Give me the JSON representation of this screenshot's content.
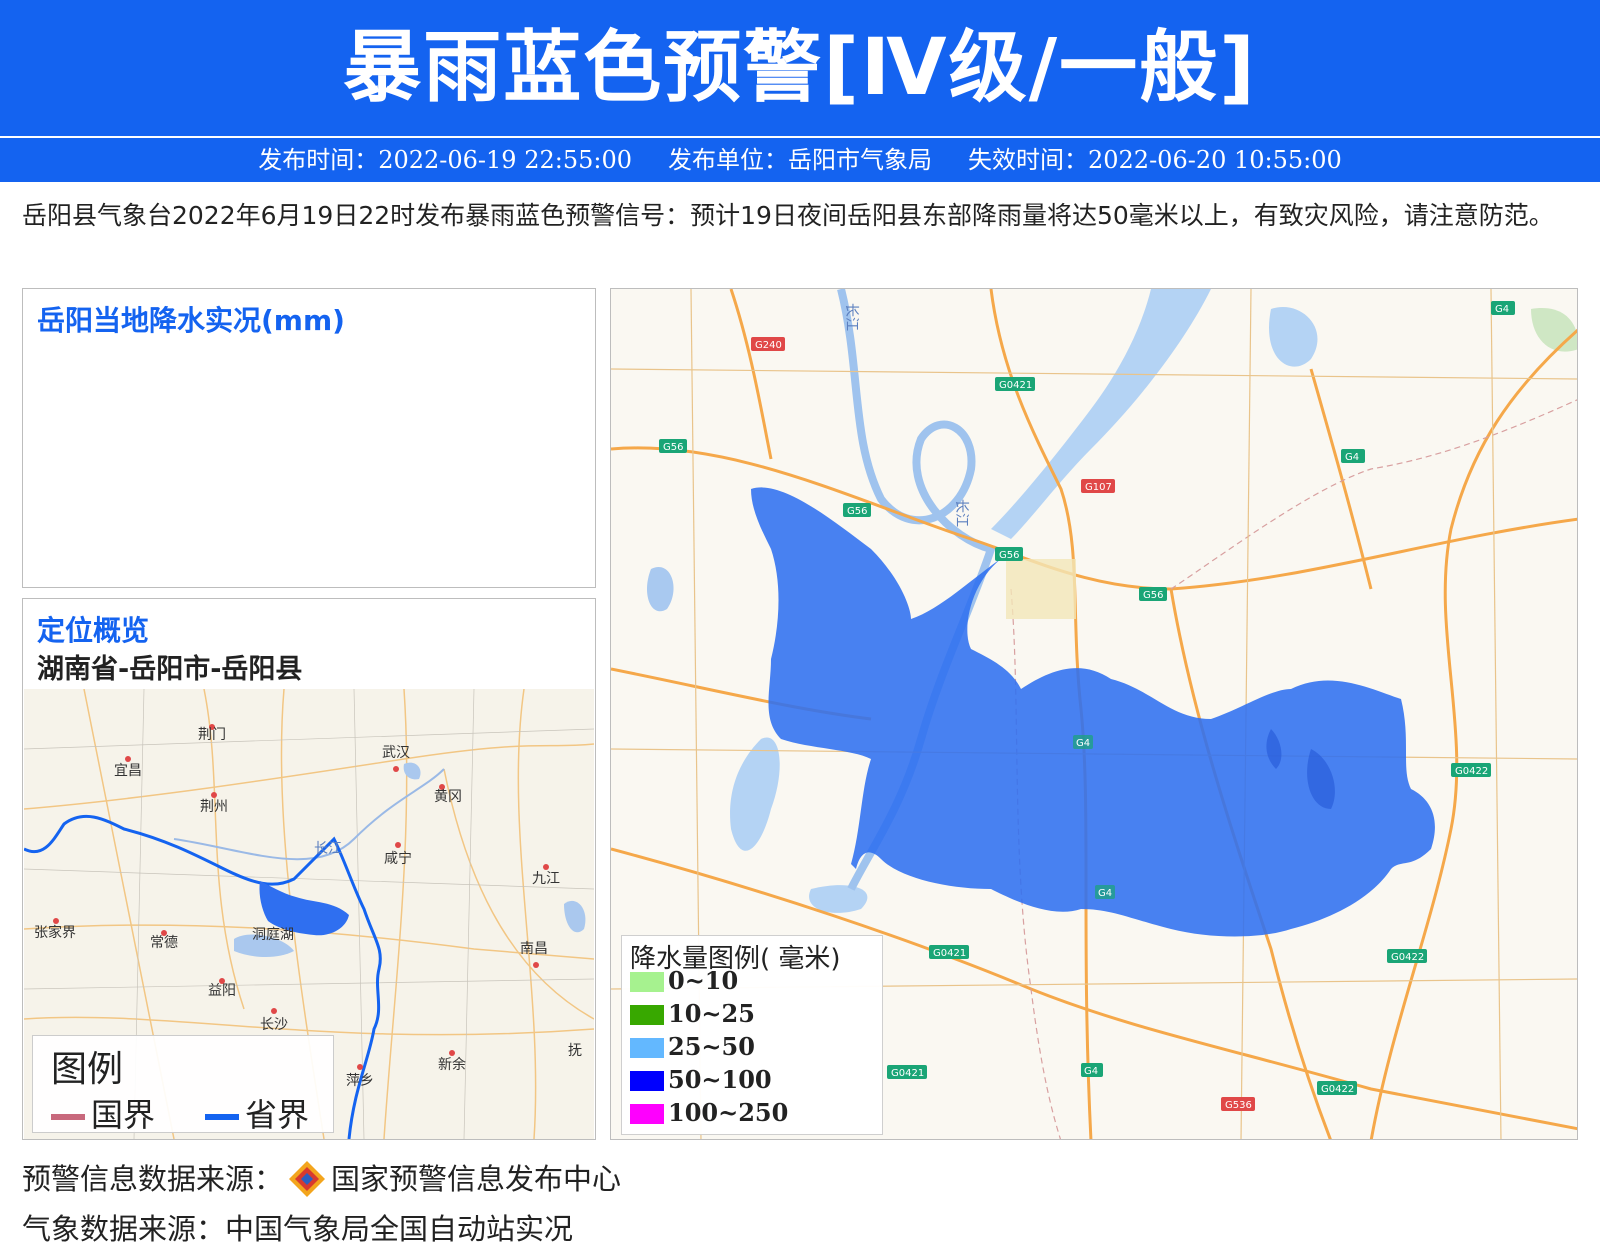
{
  "header": {
    "title": "暴雨蓝色预警[Ⅳ级/一般]",
    "publish_time": "发布时间：2022-06-19 22:55:00",
    "publisher": "发布单位：岳阳市气象局",
    "expire_time": "失效时间：2022-06-20 10:55:00"
  },
  "description": "岳阳县气象台2022年6月19日22时发布暴雨蓝色预警信号：预计19日夜间岳阳县东部降雨量将达50毫米以上，有致灾风险，请注意防范。",
  "rain_panel": {
    "title": "岳阳当地降水实况(mm)"
  },
  "locate_panel": {
    "title": "定位概览",
    "region": "湖南省-岳阳市-岳阳县",
    "cities": [
      "荆门",
      "武汉",
      "宜昌",
      "荆州",
      "黄冈",
      "咸宁",
      "九江",
      "张家界",
      "常德",
      "洞庭湖",
      "南昌",
      "益阳",
      "长沙",
      "萍乡",
      "新余",
      "抚",
      "长江"
    ],
    "legend": {
      "title": "图例",
      "items": [
        {
          "label": "国界",
          "color": "#c8687c"
        },
        {
          "label": "省界",
          "color": "#1463f0"
        }
      ]
    }
  },
  "main_map": {
    "roads": [
      "G240",
      "G0421",
      "G4",
      "G56",
      "G107",
      "G4",
      "G56",
      "G56",
      "G56",
      "G4",
      "G0422",
      "G0421",
      "G4",
      "G0422",
      "G0421",
      "G4",
      "G536",
      "G0422"
    ],
    "rivers": [
      "长江",
      "长江"
    ],
    "warning_area_color": "#2f6ff0",
    "legend": {
      "title": "降水量图例( 毫米)",
      "items": [
        {
          "label": "0~10",
          "color": "#a6f28f"
        },
        {
          "label": "10~25",
          "color": "#38a800"
        },
        {
          "label": "25~50",
          "color": "#63b8ff"
        },
        {
          "label": "50~100",
          "color": "#0000fe"
        },
        {
          "label": "100~250",
          "color": "#fe00fe"
        }
      ]
    }
  },
  "footer": {
    "warning_source_label": "预警信息数据来源：",
    "warning_source_name": "国家预警信息发布中心",
    "weather_source": "气象数据来源：中国气象局全国自动站实况"
  }
}
